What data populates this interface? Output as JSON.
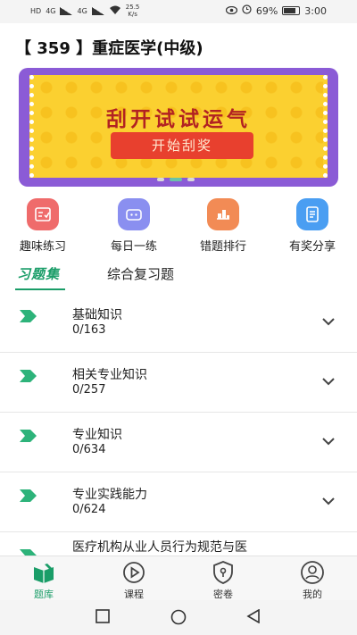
{
  "status_bar": {
    "sim1": "HD",
    "sim2": "HD",
    "net1": "4G",
    "net2": "4G",
    "speed": "25.5",
    "speed_unit": "K/s",
    "battery": "69%",
    "battery_level": 0.69,
    "time": "3:00",
    "icons": [
      "eye-icon",
      "alarm-icon",
      "battery-icon"
    ]
  },
  "page": {
    "title": "【 359 】重症医学(中级)"
  },
  "banner": {
    "headline": "刮开试试运气",
    "button": "开始刮奖",
    "colors": {
      "frame": "#8b5bd6",
      "card": "#fbd030",
      "headline": "#b22222",
      "button": "#e8402e"
    }
  },
  "quick_actions": [
    {
      "label": "趣味练习",
      "icon": "practice-icon",
      "color": "#ef6b6b"
    },
    {
      "label": "每日一练",
      "icon": "daily-icon",
      "color": "#8a8ff0"
    },
    {
      "label": "错题排行",
      "icon": "ranking-icon",
      "color": "#f28b55"
    },
    {
      "label": "有奖分享",
      "icon": "share-icon",
      "color": "#4a9ef2"
    }
  ],
  "tabs": [
    {
      "label": "习题集",
      "active": true
    },
    {
      "label": "综合复习题",
      "active": false
    }
  ],
  "exercise_list": [
    {
      "name": "基础知识",
      "progress": "0/163"
    },
    {
      "name": "相关专业知识",
      "progress": "0/257"
    },
    {
      "name": "专业知识",
      "progress": "0/634"
    },
    {
      "name": "专业实践能力",
      "progress": "0/624"
    },
    {
      "name": "医疗机构从业人员行为规范与医",
      "progress": ""
    }
  ],
  "bottom_nav": [
    {
      "label": "题库",
      "icon": "question-bank-icon",
      "active": true
    },
    {
      "label": "课程",
      "icon": "play-icon",
      "active": false
    },
    {
      "label": "密卷",
      "icon": "lock-icon",
      "active": false
    },
    {
      "label": "我的",
      "icon": "user-icon",
      "active": false
    }
  ],
  "accent_color": "#1a9d68"
}
